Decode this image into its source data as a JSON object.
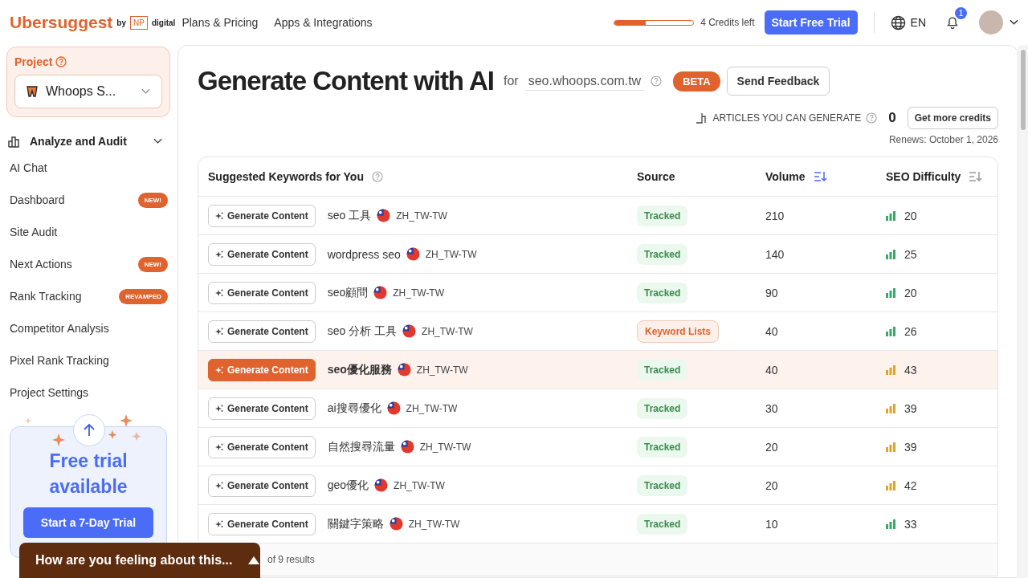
{
  "header": {
    "logo": "Ubersuggest",
    "by": "by",
    "np": "NP",
    "digital": "digital",
    "nav": [
      "Plans & Pricing",
      "Apps & Integrations"
    ],
    "credits": {
      "level": 0.4,
      "label": "4 Credits left"
    },
    "trial_button": "Start Free Trial",
    "language": "EN",
    "notifications": "1"
  },
  "sidebar": {
    "project_label": "Project",
    "project_name": "Whoops S...",
    "section": "Analyze and Audit",
    "items": [
      {
        "label": "AI Chat"
      },
      {
        "label": "Dashboard",
        "badge": "NEW!"
      },
      {
        "label": "Site Audit"
      },
      {
        "label": "Next Actions",
        "badge": "NEW!"
      },
      {
        "label": "Rank Tracking",
        "badge": "REVAMPED"
      },
      {
        "label": "Competitor Analysis"
      },
      {
        "label": "Pixel Rank Tracking"
      },
      {
        "label": "Project Settings"
      }
    ],
    "trial_card": {
      "title": "Free trial available",
      "button": "Start a 7-Day Trial"
    }
  },
  "main": {
    "title": "Generate Content with AI",
    "for": "for",
    "domain": "seo.whoops.com.tw",
    "beta": "BETA",
    "feedback_button": "Send Feedback",
    "articles_label": "ARTICLES YOU CAN GENERATE",
    "articles_count": "0",
    "more_credits": "Get more credits",
    "renews": "Renews: October 1, 2026"
  },
  "table": {
    "columns": [
      {
        "label": "Suggested Keywords for You"
      },
      {
        "label": "Source"
      },
      {
        "label": "Volume",
        "sorted": true
      },
      {
        "label": "SEO Difficulty",
        "sorted": false
      }
    ],
    "rows": [
      {
        "action": "Generate Content",
        "keyword": "seo 工具",
        "locale": "ZH_TW-TW",
        "source": "Tracked",
        "kind": "tracked",
        "volume": "210",
        "difficulty": "20",
        "color": "#3aa76d",
        "selected": false
      },
      {
        "action": "Generate Content",
        "keyword": "wordpress seo",
        "locale": "ZH_TW-TW",
        "source": "Tracked",
        "kind": "tracked",
        "volume": "140",
        "difficulty": "25",
        "color": "#3aa76d",
        "selected": false
      },
      {
        "action": "Generate Content",
        "keyword": "seo顧問",
        "locale": "ZH_TW-TW",
        "source": "Tracked",
        "kind": "tracked",
        "volume": "90",
        "difficulty": "20",
        "color": "#3aa76d",
        "selected": false
      },
      {
        "action": "Generate Content",
        "keyword": "seo 分析 工具",
        "locale": "ZH_TW-TW",
        "source": "Keyword Lists",
        "kind": "list",
        "volume": "40",
        "difficulty": "26",
        "color": "#3aa76d",
        "selected": false
      },
      {
        "action": "Generate Content",
        "keyword": "seo優化服務",
        "locale": "ZH_TW-TW",
        "source": "Tracked",
        "kind": "tracked",
        "volume": "40",
        "difficulty": "43",
        "color": "#e0a526",
        "selected": true
      },
      {
        "action": "Generate Content",
        "keyword": "ai搜尋優化",
        "locale": "ZH_TW-TW",
        "source": "Tracked",
        "kind": "tracked",
        "volume": "30",
        "difficulty": "39",
        "color": "#e0a526",
        "selected": false
      },
      {
        "action": "Generate Content",
        "keyword": "自然搜尋流量",
        "locale": "ZH_TW-TW",
        "source": "Tracked",
        "kind": "tracked",
        "volume": "20",
        "difficulty": "39",
        "color": "#e0a526",
        "selected": false
      },
      {
        "action": "Generate Content",
        "keyword": "geo優化",
        "locale": "ZH_TW-TW",
        "source": "Tracked",
        "kind": "tracked",
        "volume": "20",
        "difficulty": "42",
        "color": "#e0a526",
        "selected": false
      },
      {
        "action": "Generate Content",
        "keyword": "關鍵字策略",
        "locale": "ZH_TW-TW",
        "source": "Tracked",
        "kind": "tracked",
        "volume": "10",
        "difficulty": "33",
        "color": "#3aa76d",
        "selected": false
      }
    ],
    "footer": "of 9 results"
  },
  "feedback_popup": "How are you feeling about this..."
}
